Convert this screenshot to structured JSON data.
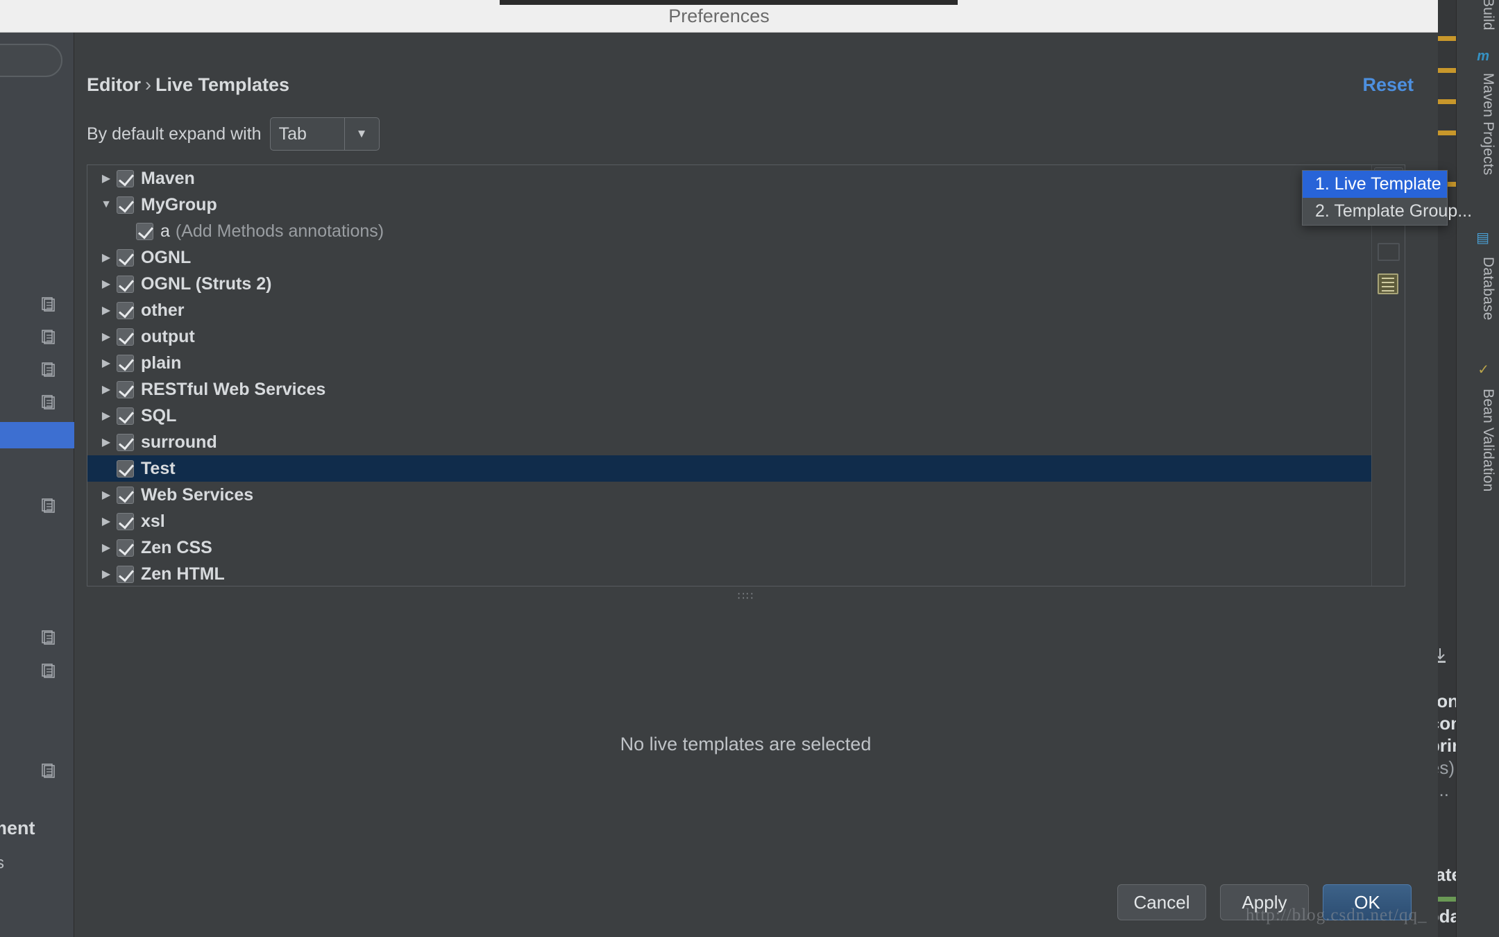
{
  "window": {
    "title": "Preferences"
  },
  "dialog": {
    "breadcrumb_root": "Editor",
    "breadcrumb_sep": "›",
    "breadcrumb_leaf": "Live Templates",
    "reset_label": "Reset",
    "expand_label": "By default expand with",
    "expand_value": "Tab",
    "expand_arrow": "▼",
    "empty_message": "No live templates are selected",
    "splitter_dots": "∷∷"
  },
  "toolbar": {
    "add_icon": "+",
    "add_icon_name": "plus-icon",
    "copy_icon_name": "copy-icon",
    "doc_icon_name": "document-icon"
  },
  "tree": {
    "collapsed_twisty": "▶",
    "expanded_twisty": "▼",
    "items": [
      {
        "label": "Maven",
        "checked": true,
        "expanded": false,
        "child": false,
        "selected": false,
        "sub": ""
      },
      {
        "label": "MyGroup",
        "checked": true,
        "expanded": true,
        "child": false,
        "selected": false,
        "sub": ""
      },
      {
        "label": "a",
        "checked": true,
        "expanded": null,
        "child": true,
        "selected": false,
        "sub": "(Add Methods annotations)"
      },
      {
        "label": "OGNL",
        "checked": true,
        "expanded": false,
        "child": false,
        "selected": false,
        "sub": ""
      },
      {
        "label": "OGNL (Struts 2)",
        "checked": true,
        "expanded": false,
        "child": false,
        "selected": false,
        "sub": ""
      },
      {
        "label": "other",
        "checked": true,
        "expanded": false,
        "child": false,
        "selected": false,
        "sub": ""
      },
      {
        "label": "output",
        "checked": true,
        "expanded": false,
        "child": false,
        "selected": false,
        "sub": ""
      },
      {
        "label": "plain",
        "checked": true,
        "expanded": false,
        "child": false,
        "selected": false,
        "sub": ""
      },
      {
        "label": "RESTful Web Services",
        "checked": true,
        "expanded": false,
        "child": false,
        "selected": false,
        "sub": ""
      },
      {
        "label": "SQL",
        "checked": true,
        "expanded": false,
        "child": false,
        "selected": false,
        "sub": ""
      },
      {
        "label": "surround",
        "checked": true,
        "expanded": false,
        "child": false,
        "selected": false,
        "sub": ""
      },
      {
        "label": "Test",
        "checked": true,
        "expanded": null,
        "child": false,
        "selected": true,
        "sub": ""
      },
      {
        "label": "Web Services",
        "checked": true,
        "expanded": false,
        "child": false,
        "selected": false,
        "sub": ""
      },
      {
        "label": "xsl",
        "checked": true,
        "expanded": false,
        "child": false,
        "selected": false,
        "sub": ""
      },
      {
        "label": "Zen CSS",
        "checked": true,
        "expanded": false,
        "child": false,
        "selected": false,
        "sub": ""
      },
      {
        "label": "Zen HTML",
        "checked": true,
        "expanded": false,
        "child": false,
        "selected": false,
        "sub": ""
      }
    ]
  },
  "popup_menu": {
    "items": [
      {
        "label": "1. Live Template",
        "active": true
      },
      {
        "label": "2. Template Group...",
        "active": false
      }
    ]
  },
  "buttons": {
    "cancel": "Cancel",
    "apply": "Apply",
    "ok": "OK"
  },
  "background": {
    "vertical_tabs": [
      "Build",
      "Maven Projects",
      "Database",
      "Bean Validation"
    ],
    "text_fragments": [
      "ment",
      "tion",
      "con",
      "Sprin",
      "les)",
      "e...",
      "odate",
      "Jpda"
    ],
    "watermark": "http://blog.csdn.net/qq_"
  },
  "colors": {
    "accent_blue": "#2864d8",
    "link_blue": "#4d90e0",
    "selection_navy": "#102c4b",
    "dialog_bg": "#3c3f41",
    "titlebar_bg": "#efefef",
    "marker_gold": "#c8972b"
  }
}
